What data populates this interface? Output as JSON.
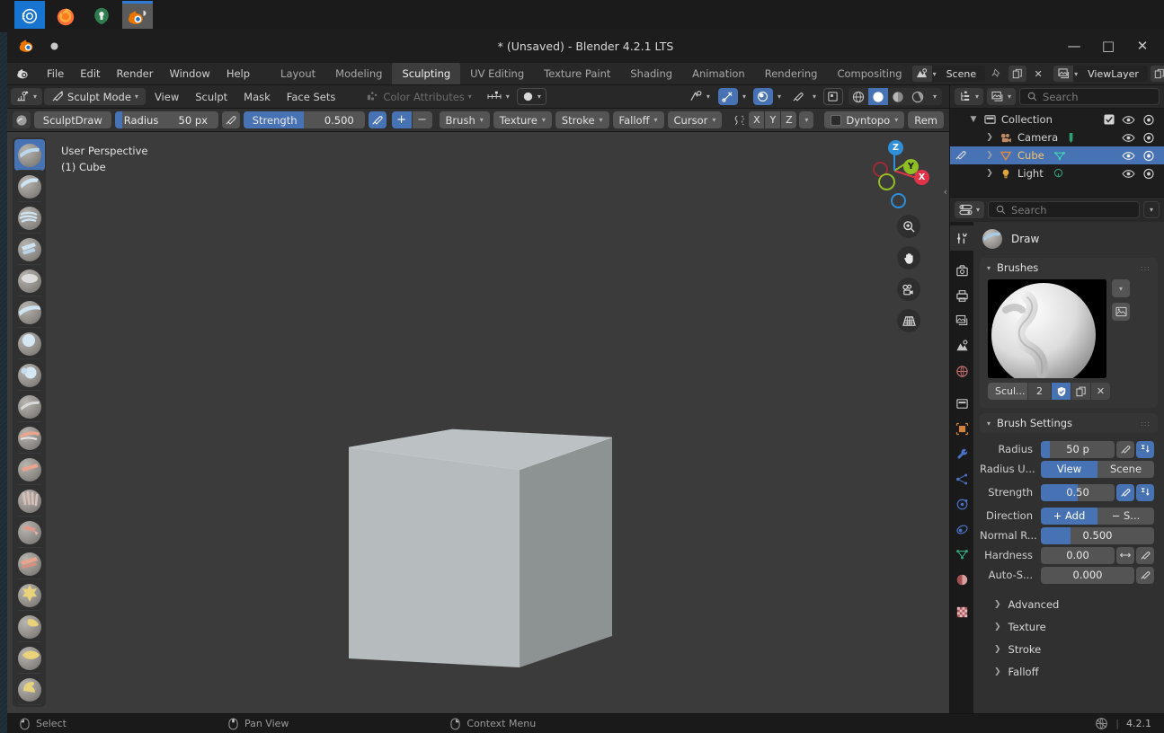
{
  "taskbar": {
    "items": [
      {
        "name": "app-icon-settings",
        "label": "Settings"
      },
      {
        "name": "app-icon-firefox",
        "label": "Firefox"
      },
      {
        "name": "app-icon-tools",
        "label": "Tools"
      },
      {
        "name": "app-icon-blender",
        "label": "Blender"
      }
    ]
  },
  "window": {
    "title": "* (Unsaved) - Blender 4.2.1 LTS",
    "minimize": "—",
    "maximize": "□",
    "close": "✕"
  },
  "topbar": {
    "menus": [
      "File",
      "Edit",
      "Render",
      "Window",
      "Help"
    ],
    "workspaces": [
      {
        "label": "Layout",
        "active": false
      },
      {
        "label": "Modeling",
        "active": false
      },
      {
        "label": "Sculpting",
        "active": true
      },
      {
        "label": "UV Editing",
        "active": false
      },
      {
        "label": "Texture Paint",
        "active": false
      },
      {
        "label": "Shading",
        "active": false
      },
      {
        "label": "Animation",
        "active": false
      },
      {
        "label": "Rendering",
        "active": false
      },
      {
        "label": "Compositing",
        "active": false
      }
    ],
    "scene": {
      "label": "Scene",
      "icon": "scene-icon"
    },
    "view_layer": {
      "label": "ViewLayer",
      "icon": "view-layer-icon"
    }
  },
  "viewport_header": {
    "editor_type_icon": "editor-type-icon",
    "mode": "Sculpt Mode",
    "menus": [
      "View",
      "Sculpt",
      "Mask",
      "Face Sets"
    ],
    "color_attributes": "Color Attributes",
    "right_icons": [
      "visibility-icon",
      "snap-icon",
      "proportional-edit-icon",
      "brush-icon",
      "overlays-icon",
      "xray-icon",
      "shading-wireframe",
      "shading-solid",
      "shading-material",
      "shading-rendered"
    ]
  },
  "tool_settings": {
    "brush_name": "SculptDraw",
    "radius": {
      "label": "Radius",
      "value": "50 px",
      "fill_pct": 6
    },
    "strength": {
      "label": "Strength",
      "value": "0.500",
      "fill_pct": 50
    },
    "add_label": "+",
    "subtract_label": "−",
    "dropdowns": [
      "Brush",
      "Texture",
      "Stroke",
      "Falloff",
      "Cursor"
    ],
    "symmetry": {
      "x": "X",
      "y": "Y",
      "z": "Z"
    },
    "dyntopo": "Dyntopo",
    "remesh": "Rem"
  },
  "viewport": {
    "perspective_label": "User Perspective",
    "object_label": "(1) Cube",
    "gizmo_axes": [
      {
        "label": "Z",
        "color": "#2f8fd8"
      },
      {
        "label": "Y",
        "color": "#8fbf22"
      },
      {
        "label": "X",
        "color": "#e0334a"
      }
    ],
    "nav_buttons": [
      "zoom-icon",
      "pan-hand-icon",
      "camera-view-icon",
      "toggle-perspective-icon"
    ],
    "toolbar_tools": [
      {
        "name": "tool-draw",
        "label": "Draw",
        "active": true,
        "overlay": "#bcd8ee"
      },
      {
        "name": "tool-draw-sharp",
        "label": "Draw Sharp",
        "active": false,
        "overlay": "#cfe4f2"
      },
      {
        "name": "tool-clay",
        "label": "Clay",
        "active": false,
        "overlay": "#cfe4f2"
      },
      {
        "name": "tool-clay-strips",
        "label": "Clay Strips",
        "active": false,
        "overlay": "#cfe4f2"
      },
      {
        "name": "tool-clay-thumb",
        "label": "Clay Thumb",
        "active": false,
        "overlay": "#dcdcdc"
      },
      {
        "name": "tool-layer",
        "label": "Layer",
        "active": false,
        "overlay": "#cfe4f2"
      },
      {
        "name": "tool-inflate",
        "label": "Inflate",
        "active": false,
        "overlay": "#d6e7f4"
      },
      {
        "name": "tool-blob",
        "label": "Blob",
        "active": false,
        "overlay": "#d6e7f4"
      },
      {
        "name": "tool-crease",
        "label": "Crease",
        "active": false,
        "overlay": "#dadada"
      },
      {
        "name": "tool-smooth",
        "label": "Smooth",
        "active": false,
        "overlay": "#e8a48c"
      },
      {
        "name": "tool-flatten",
        "label": "Flatten",
        "active": false,
        "overlay": "#e8a48c"
      },
      {
        "name": "tool-fill",
        "label": "Fill",
        "active": false,
        "overlay": "#d8c0b8"
      },
      {
        "name": "tool-scrape",
        "label": "Scrape",
        "active": false,
        "overlay": "#e0978c"
      },
      {
        "name": "tool-multiplane-scrape",
        "label": "Multiplane Scrape",
        "active": false,
        "overlay": "#e8a48c"
      },
      {
        "name": "tool-pinch",
        "label": "Pinch",
        "active": false,
        "overlay": "#e8d27a"
      },
      {
        "name": "tool-grab",
        "label": "Grab",
        "active": false,
        "overlay": "#e8d27a"
      },
      {
        "name": "tool-elastic-deform",
        "label": "Elastic Deform",
        "active": false,
        "overlay": "#e8d27a"
      },
      {
        "name": "tool-snake-hook",
        "label": "Snake Hook",
        "active": false,
        "overlay": "#e8d27a"
      }
    ]
  },
  "outliner": {
    "search_placeholder": "Search",
    "rows": [
      {
        "name": "Collection",
        "icon": "collection-icon",
        "depth": 0,
        "selected": false,
        "expanded": true,
        "checkbox": true,
        "eye": true,
        "camera": true
      },
      {
        "name": "Camera",
        "icon": "camera-icon",
        "depth": 1,
        "selected": false,
        "expanded": false,
        "checkbox": false,
        "eye": true,
        "camera": true
      },
      {
        "name": "Cube",
        "icon": "mesh-icon",
        "depth": 1,
        "selected": true,
        "expanded": false,
        "checkbox": false,
        "eye": true,
        "camera": true
      },
      {
        "name": "Light",
        "icon": "light-icon",
        "depth": 1,
        "selected": false,
        "expanded": false,
        "checkbox": false,
        "eye": true,
        "camera": true
      }
    ]
  },
  "properties": {
    "search_placeholder": "Search",
    "active_brush": "Draw",
    "tabs": [
      {
        "name": "tool-tab",
        "icon": "tool-icon",
        "active": true
      },
      {
        "name": "render-tab",
        "icon": "render-icon",
        "active": false
      },
      {
        "name": "output-tab",
        "icon": "printer-icon",
        "active": false
      },
      {
        "name": "view-layer-tab",
        "icon": "images-icon",
        "active": false
      },
      {
        "name": "scene-tab",
        "icon": "scene-cone-icon",
        "active": false
      },
      {
        "name": "world-tab",
        "icon": "world-icon",
        "active": false
      },
      {
        "name": "collection-tab",
        "icon": "box-icon",
        "active": false
      },
      {
        "name": "object-tab",
        "icon": "object-square-icon",
        "active": false
      },
      {
        "name": "modifier-tab",
        "icon": "wrench-icon",
        "active": false
      },
      {
        "name": "particles-tab",
        "icon": "particles-icon",
        "active": false
      },
      {
        "name": "physics-tab",
        "icon": "physics-orbit-icon",
        "active": false
      },
      {
        "name": "constraints-tab",
        "icon": "constraint-icon",
        "active": false
      },
      {
        "name": "data-tab",
        "icon": "mesh-data-icon",
        "active": false
      },
      {
        "name": "material-tab",
        "icon": "material-sphere-icon",
        "active": false
      },
      {
        "name": "texture-tab",
        "icon": "checker-texture-icon",
        "active": false
      }
    ],
    "brushes_panel": {
      "title": "Brushes",
      "id_name": "Scul...",
      "users_count": "2",
      "fake_user_icon": "shield-icon",
      "duplicate_icon": "copy-icon",
      "unlink_icon": "x-icon"
    },
    "brush_settings_panel": {
      "title": "Brush Settings",
      "radius": {
        "label": "Radius",
        "value": "50 p",
        "fill_pct": 12
      },
      "radius_unit": {
        "label": "Radius U...",
        "options": [
          "View",
          "Scene"
        ],
        "selected": "View"
      },
      "strength": {
        "label": "Strength",
        "value": "0.50",
        "fill_pct": 50
      },
      "direction": {
        "label": "Direction",
        "options": [
          "+ Add",
          "− S..."
        ],
        "selected": "+ Add"
      },
      "normal_radius": {
        "label": "Normal R...",
        "value": "0.500",
        "fill_pct": 26
      },
      "hardness": {
        "label": "Hardness",
        "value": "0.00",
        "fill_pct": 0
      },
      "auto_smooth": {
        "label": "Auto-S...",
        "value": "0.000",
        "fill_pct": 0
      },
      "subpanels": [
        "Advanced",
        "Texture",
        "Stroke",
        "Falloff"
      ]
    }
  },
  "status_bar": {
    "hints": [
      {
        "label": "Select",
        "button": "left"
      },
      {
        "label": "Pan View",
        "button": "middle"
      },
      {
        "label": "Context Menu",
        "button": "right"
      }
    ],
    "version": "4.2.1",
    "scene_stats_icon": "scene-stats-icon"
  },
  "colors": {
    "accent_blue": "#4772b3",
    "header_bg": "#282828",
    "panel_bg": "#303030",
    "viewport_bg": "#3b3b3b",
    "cube_front": "#b6bcbd",
    "cube_top": "#bcc2c3",
    "cube_side": "#8d9293"
  }
}
